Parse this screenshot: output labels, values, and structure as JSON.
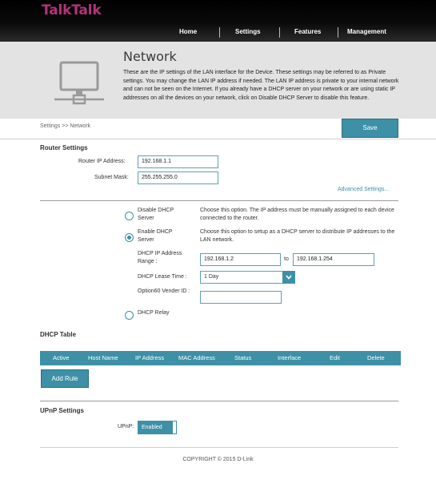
{
  "brand": "TalkTalk",
  "nav": [
    "Home",
    "Settings",
    "Features",
    "Management"
  ],
  "page": {
    "title": "Network",
    "description": "These are the IP settings of the LAN interface for the Device. These settings may be referred to as Private settings. You may change the LAN IP address if needed. The LAN IP address is private to your internal network and can not be seen on the Internet. If you already have a DHCP server on your network or are using static IP addresses on all the devices on your network, click on Disable DHCP Server to disable this feature."
  },
  "breadcrumb": "Settings >> Network",
  "save_label": "Save",
  "router": {
    "title": "Router Settings",
    "ip_label": "Router IP Address:",
    "ip_value": "192.168.1.1",
    "mask_label": "Subnet Mask:",
    "mask_value": "255.255.255.0",
    "advanced_link": "Advanced Settings..."
  },
  "dhcp": {
    "disable_label": "Disable DHCP Server",
    "disable_desc": "Choose this option. The IP address must be manually assigned to each device connected to the router.",
    "enable_label": "Enable DHCP Server",
    "enable_desc": "Choose this option to setup as a DHCP server to distribute IP addresses to the LAN network.",
    "range_label": "DHCP IP Address Range :",
    "range_start": "192.168.1.2",
    "range_to": "to",
    "range_end": "192.168.1.254",
    "lease_label": "DHCP Lease Time :",
    "lease_value": "1 Day",
    "option60_label": "Option60 Vender ID :",
    "option60_value": "",
    "relay_label": "DHCP Relay",
    "selected": "enable"
  },
  "dhcp_table": {
    "title": "DHCP Table",
    "columns": [
      "Active",
      "Host Name",
      "IP Address",
      "MAC Address",
      "Status",
      "Interface",
      "Edit",
      "Delete"
    ],
    "add_rule_label": "Add Rule"
  },
  "upnp": {
    "title": "UPnP Settings",
    "label": "UPnP:",
    "state": "Enabled"
  },
  "footer": "COPYRIGHT © 2015 D-Link",
  "colors": {
    "brand": "#b4337a",
    "accent": "#3d90a6",
    "link": "#3a8ca8"
  }
}
